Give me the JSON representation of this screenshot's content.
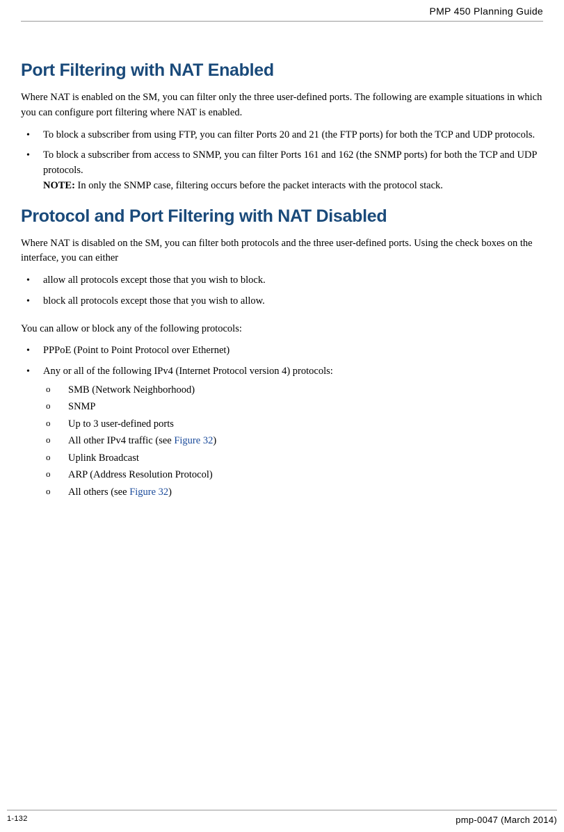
{
  "header": {
    "title": "PMP 450 Planning Guide"
  },
  "section1": {
    "heading": "Port Filtering with NAT Enabled",
    "intro": "Where NAT is enabled on the SM, you can filter only the three user-defined ports. The following are example situations in which you can configure port filtering where NAT is enabled.",
    "bullets": [
      "To block a subscriber from using FTP, you can filter Ports 20 and 21 (the FTP ports) for both the TCP and UDP protocols.",
      "To block a subscriber from access to SNMP, you can filter Ports 161 and 162 (the SNMP ports) for both the TCP and UDP protocols."
    ],
    "note_label": "NOTE:",
    "note_text": " In only the SNMP case, filtering occurs before the packet interacts with the protocol stack."
  },
  "section2": {
    "heading": "Protocol and Port Filtering with NAT Disabled",
    "intro": "Where NAT is disabled on the SM, you can filter both protocols and the three user-defined ports. Using the check boxes on the interface, you can either",
    "bullets": [
      "allow all protocols except those that you wish to block.",
      "block all protocols except those that you wish to allow."
    ],
    "para2": "You can allow or block any of the following protocols:",
    "list2": {
      "item1": "PPPoE (Point to Point Protocol over Ethernet)",
      "item2": "Any or all of the following IPv4 (Internet Protocol version 4) protocols:",
      "sub": [
        "SMB (Network Neighborhood)",
        "SNMP",
        "Up to 3 user-defined ports"
      ],
      "sub4_pre": "All other IPv4 traffic (see ",
      "sub4_link": "Figure 32",
      "sub4_post": ")",
      "sub5": "Uplink Broadcast",
      "sub6": "ARP (Address Resolution Protocol)",
      "sub7_pre": "All others (see ",
      "sub7_link": "Figure 32",
      "sub7_post": ")"
    }
  },
  "footer": {
    "page": "1-132",
    "doc": "pmp-0047 (March 2014)"
  }
}
